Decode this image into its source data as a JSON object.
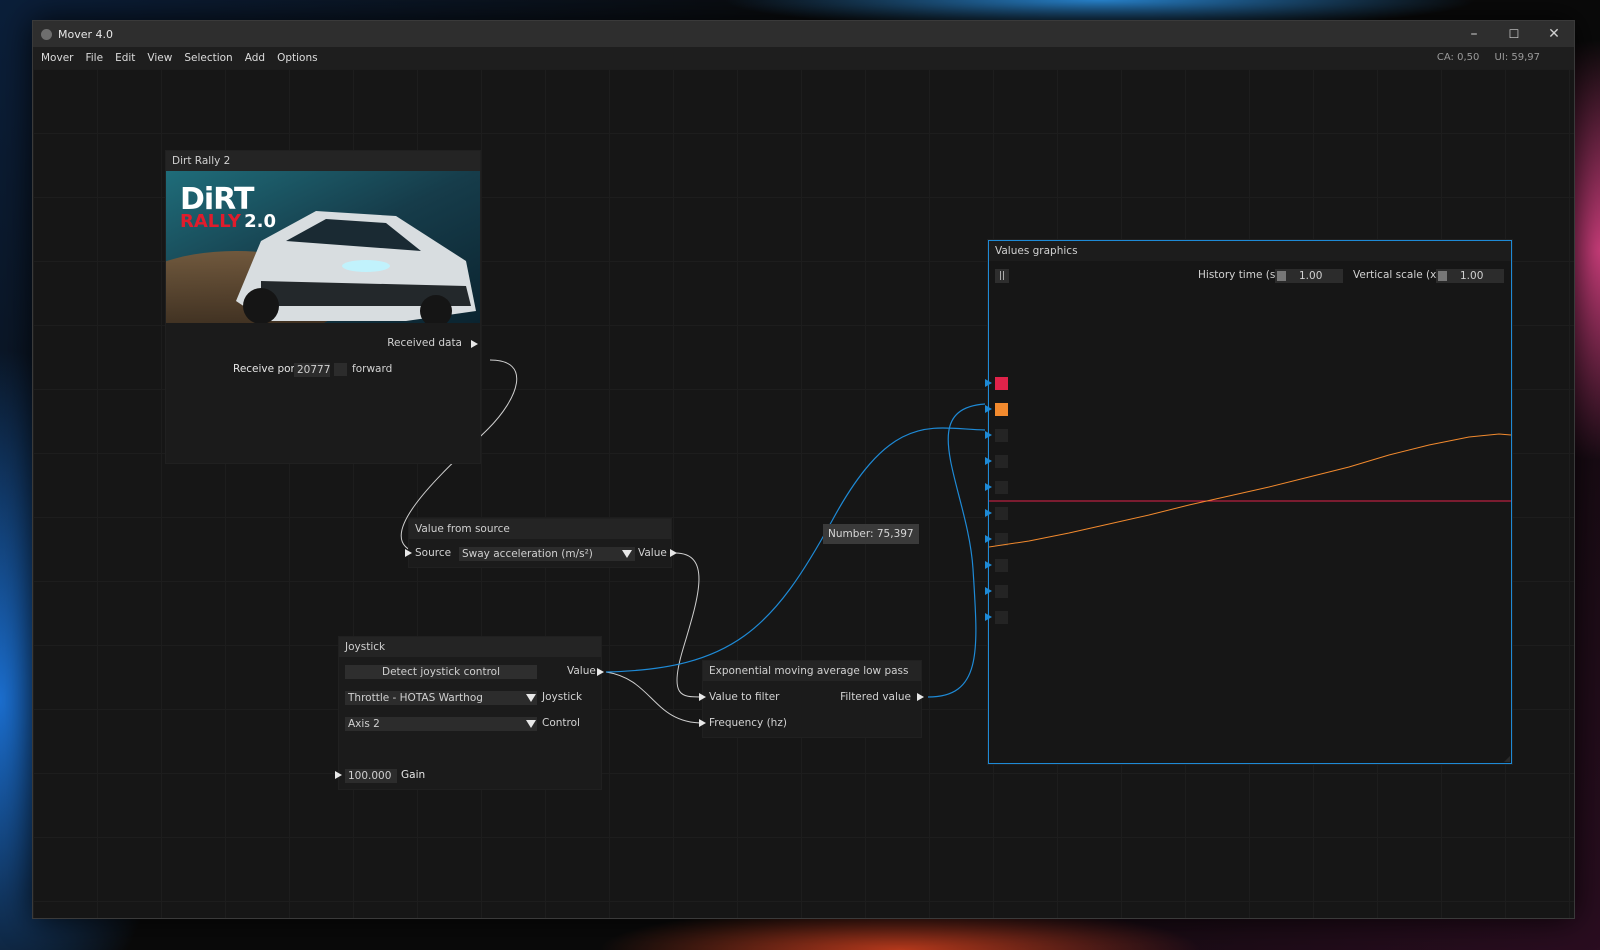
{
  "window": {
    "title": "Mover 4.0",
    "controls": {
      "minimize": "–",
      "maximize": "☐",
      "close": "✕"
    }
  },
  "menu": {
    "items": [
      "Mover",
      "File",
      "Edit",
      "View",
      "Selection",
      "Add",
      "Options"
    ]
  },
  "perf": {
    "ca": "CA: 0,50",
    "ui": "UI: 59,97"
  },
  "nodes": {
    "dirt": {
      "title": "Dirt Rally 2",
      "logo_line1": "DiRT",
      "logo_line2": "RALLY",
      "logo_line3": "2.0",
      "received_label": "Received data",
      "port_label": "Receive port",
      "port_value": "20777",
      "forward_label": "forward"
    },
    "value_source": {
      "title": "Value from source",
      "source_label": "Source",
      "select_value": "Sway acceleration (m/s²)",
      "value_label": "Value"
    },
    "joystick": {
      "title": "Joystick",
      "detect_button": "Detect joystick control",
      "value_label": "Value",
      "joystick_select": "Throttle - HOTAS Warthog",
      "joystick_label": "Joystick",
      "control_select": "Axis 2",
      "control_label": "Control",
      "gain_value": "100.000",
      "gain_label": "Gain"
    },
    "ema": {
      "title": "Exponential moving average low pass",
      "input_label": "Value to filter",
      "output_label": "Filtered value",
      "freq_label": "Frequency (hz)"
    },
    "graph": {
      "title": "Values graphics",
      "pause_icon": "||",
      "history_label": "History time (s)",
      "history_value": "1.00",
      "vscale_label": "Vertical scale (x)",
      "vscale_value": "1.00",
      "series_colors": [
        "#e0234a",
        "#f28a2e"
      ]
    }
  },
  "tooltip": {
    "text": "Number: 75,397"
  },
  "colors": {
    "link_white": "#d0d0d0",
    "link_blue": "#1e8ad6",
    "accent_blue": "#1e8ad6"
  }
}
